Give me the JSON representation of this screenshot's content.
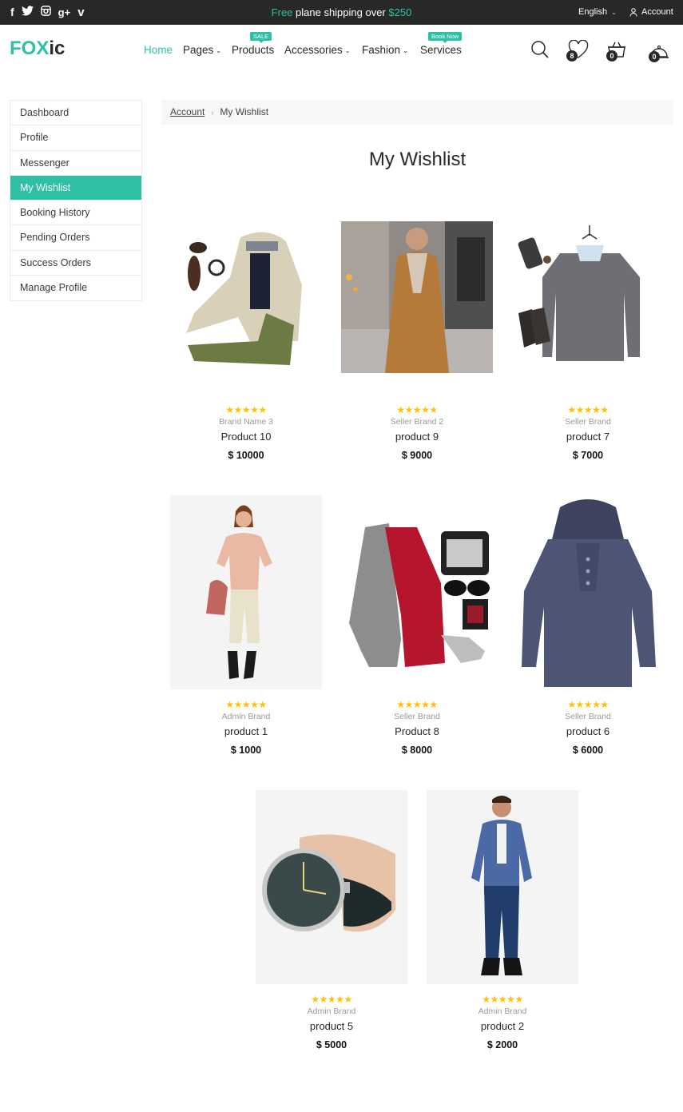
{
  "topbar": {
    "social": [
      "facebook-icon",
      "twitter-icon",
      "instagram-icon",
      "google-plus-icon",
      "vimeo-icon"
    ],
    "message_accent": "Free",
    "message_main": " plane shipping over ",
    "message_amount": "$250",
    "language": "English",
    "account": "Account"
  },
  "header": {
    "logo_part1": "FOX",
    "logo_part2": "ic",
    "nav": {
      "home": "Home",
      "pages": "Pages",
      "products": "Products",
      "products_badge": "SALE",
      "accessories": "Accessories",
      "fashion": "Fashion",
      "services": "Services",
      "services_badge": "Book Now"
    },
    "icons": [
      "search-icon",
      "heart-icon",
      "basket-icon",
      "bell-icon"
    ],
    "wishlist_count": "8",
    "cart_count": "0",
    "notification_count": "0"
  },
  "sidebar": {
    "items": [
      {
        "label": "Dashboard"
      },
      {
        "label": "Profile"
      },
      {
        "label": "Messenger"
      },
      {
        "label": "My Wishlist"
      },
      {
        "label": "Booking History"
      },
      {
        "label": "Pending Orders"
      },
      {
        "label": "Success Orders"
      },
      {
        "label": "Manage Profile"
      }
    ],
    "active_index": 3
  },
  "breadcrumb": {
    "parent": "Account",
    "current": "My Wishlist"
  },
  "page_title": "My Wishlist",
  "products": [
    {
      "stars": "★★★★★",
      "brand": "Brand Name 3",
      "name": "Product 10",
      "price": "$ 10000"
    },
    {
      "stars": "★★★★★",
      "brand": "Seller Brand 2",
      "name": "product 9",
      "price": "$ 9000"
    },
    {
      "stars": "★★★★★",
      "brand": "Seller Brand",
      "name": "product 7",
      "price": "$ 7000"
    },
    {
      "stars": "★★★★★",
      "brand": "Admin Brand",
      "name": "product 1",
      "price": "$ 1000"
    },
    {
      "stars": "★★★★★",
      "brand": "Seller Brand",
      "name": "Product 8",
      "price": "$ 8000"
    },
    {
      "stars": "★★★★★",
      "brand": "Seller Brand",
      "name": "product 6",
      "price": "$ 6000"
    },
    {
      "stars": "★★★★★",
      "brand": "Admin Brand",
      "name": "product 5",
      "price": "$ 5000"
    },
    {
      "stars": "★★★★★",
      "brand": "Admin Brand",
      "name": "product 2",
      "price": "$ 2000"
    }
  ],
  "colors": {
    "accent": "#2dc0a5",
    "topbar": "#282828",
    "star": "#ffc107"
  }
}
